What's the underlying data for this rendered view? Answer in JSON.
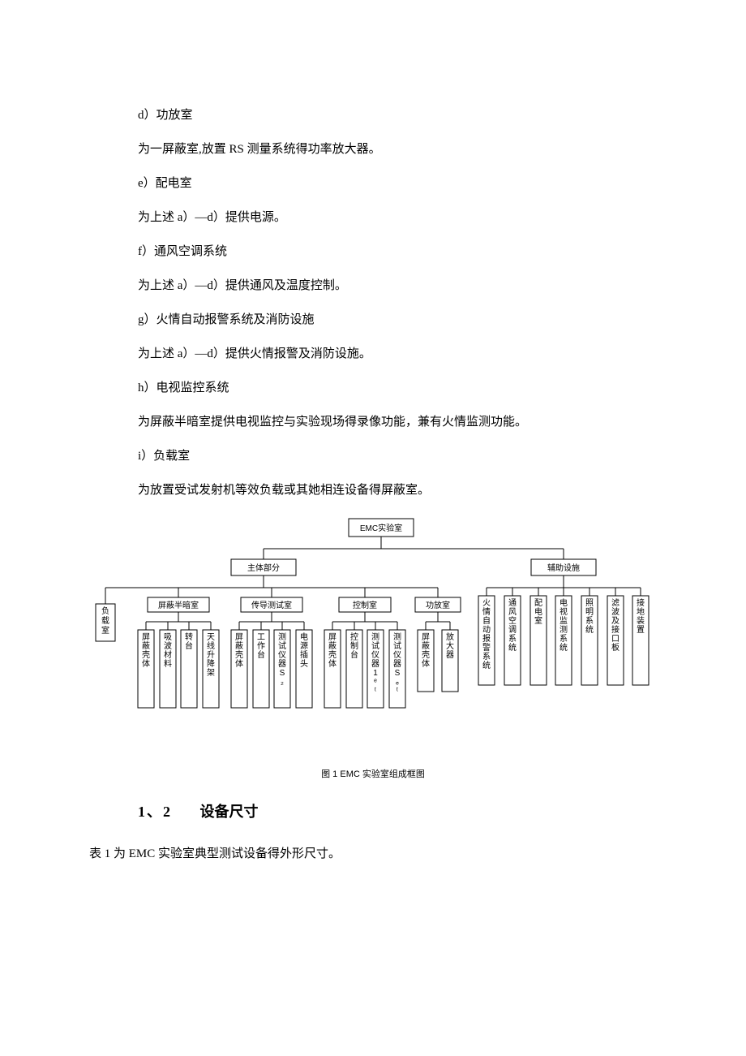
{
  "paragraphs": {
    "d_head": "d）功放室",
    "d_body": "为一屏蔽室,放置 RS 测量系统得功率放大器。",
    "e_head": "e）配电室",
    "e_body": "为上述 a）—d）提供电源。",
    "f_head": "f）通风空调系统",
    "f_body": "为上述 a）—d）提供通风及温度控制。",
    "g_head": "g）火情自动报警系统及消防设施",
    "g_body": "为上述 a）—d）提供火情报警及消防设施。",
    "h_head": "h）电视监控系统",
    "h_body": "为屏蔽半暗室提供电视监控与实验现场得录像功能，兼有火情监测功能。",
    "i_head": "i）负载室",
    "i_body": "为放置受试发射机等效负载或其她相连设备得屏蔽室。"
  },
  "section": {
    "num": "1、2",
    "title": "设备尺寸"
  },
  "table_note": "表 1 为 EMC 实验室典型测试设备得外形尺寸。",
  "diagram": {
    "caption": "图 1  EMC 实验室组成框图",
    "root": "EMC实验室",
    "l1": {
      "main": "主体部分",
      "aux": "辅助设施"
    },
    "main_children": {
      "load": "负载室",
      "shield": "屏蔽半暗室",
      "conduct": "传导测试室",
      "control": "控制室",
      "amp": "功放室"
    },
    "shield_leaves": [
      "屏蔽壳体",
      "吸波材料",
      "转台",
      "天线升降架"
    ],
    "conduct_leaves": [
      "屏蔽壳体",
      "工作台",
      "测试仪器S₂",
      "电源插头"
    ],
    "control_leaves": [
      "屏蔽壳体",
      "控制台",
      "测试仪器1ᵉᵗ",
      "测试仪器Sₑᵗ"
    ],
    "amp_leaves": [
      "屏蔽壳体",
      "放大器"
    ],
    "aux_leaves": [
      "火情自动报警系统",
      "通风空调系统",
      "配电室",
      "电视监测系统",
      "照明系统",
      "滤波及接口板",
      "接地装置"
    ]
  }
}
